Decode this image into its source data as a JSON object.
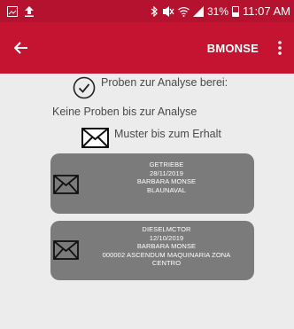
{
  "status_bar": {
    "time": "11:07 AM",
    "battery_percent": "31%",
    "icons": [
      "image-icon",
      "upload-icon",
      "bluetooth-icon",
      "mute-icon",
      "wifi-icon",
      "signal-icon",
      "battery-icon"
    ]
  },
  "app_bar": {
    "back_icon": "arrow-left-icon",
    "title": "BMONSE",
    "overflow_icon": "more-vert-icon",
    "background_color": "#c41432"
  },
  "content": {
    "ready_text": "Proben zur Analyse berei:",
    "no_samples_text": "Keine Proben bis zur Analyse",
    "samples_text": "Muster bis zum Erhalt"
  },
  "cards": [
    {
      "lines": [
        "GETRIEBE",
        "28/11/2019",
        "BARBARA MONSE",
        "BLAUNAVAL"
      ]
    },
    {
      "lines": [
        "DIESELMCTOR",
        "12/10/2019",
        "BARBARA MONSE",
        "000002 ASCENDUM MAQUINARIA ZONA",
        "CENTRO"
      ]
    }
  ]
}
